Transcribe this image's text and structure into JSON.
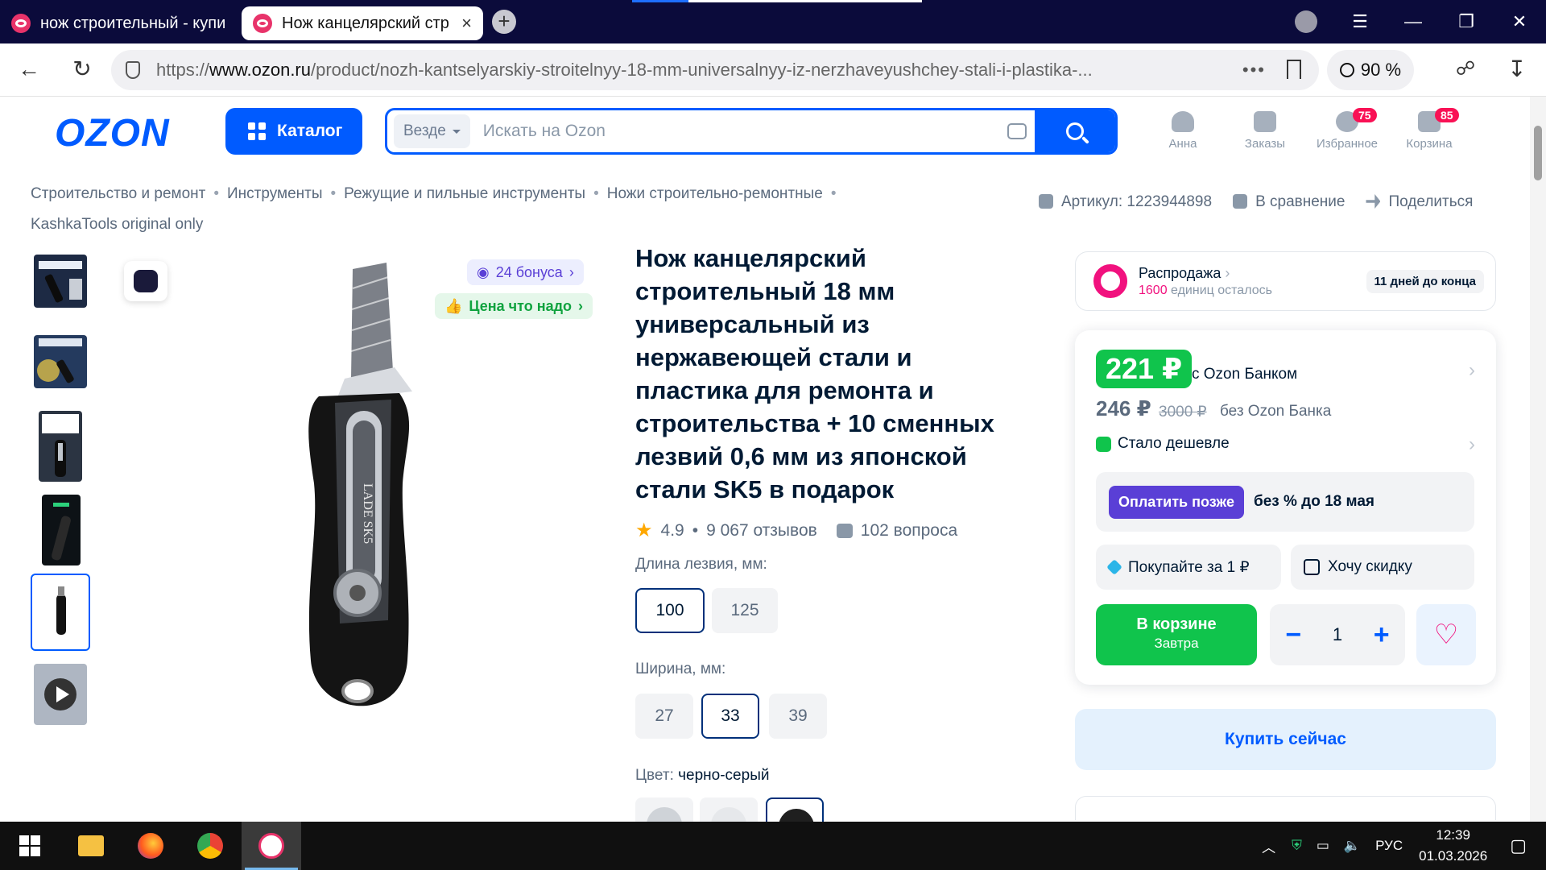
{
  "browser": {
    "tabs": [
      {
        "title": "нож строительный - купи",
        "active": false
      },
      {
        "title": "Нож канцелярский стр",
        "active": true
      }
    ],
    "new_tab": "+",
    "close": "×",
    "url_prefix": "https://",
    "url_host": "www.ozon.ru",
    "url_path": "/product/nozh-kantselyarskiy-stroitelnyy-18-mm-universalnyy-iz-nerzhaveyushchey-stali-i-plastika-...",
    "zoom": "90 %",
    "window_controls": [
      "☰",
      "—",
      "❐",
      "✕"
    ]
  },
  "header": {
    "logo": "OZON",
    "catalog_label": "Каталог",
    "search_scope": "Везде",
    "search_placeholder": "Искать на Ozon",
    "user": {
      "label": "Анна"
    },
    "orders": {
      "label": "Заказы"
    },
    "favorites": {
      "label": "Избранное",
      "count": "75"
    },
    "cart": {
      "label": "Корзина",
      "count": "85"
    }
  },
  "breadcrumb": [
    "Строительство и ремонт",
    "Инструменты",
    "Режущие и пильные инструменты",
    "Ножи строительно-ремонтные",
    "KashkaTools original only"
  ],
  "article_bar": {
    "article": "Артикул: 1223944898",
    "compare": "В сравнение",
    "share": "Поделиться"
  },
  "gallery": {
    "bonus": "24 бонуса",
    "price_tag": "Цена что надо"
  },
  "product": {
    "title": "Нож канцелярский строительный 18 мм универсальный из нержавеющей стали и пластика для ремонта и строительства + 10 сменных лезвий 0,6 мм из японской стали SK5 в подарок",
    "rating": "4.9",
    "reviews": "9 067 отзывов",
    "questions": "102 вопроса",
    "blade_length_label": "Длина лезвия, мм:",
    "blade_lengths": [
      "100",
      "125"
    ],
    "blade_length_selected": "100",
    "width_label": "Ширина, мм:",
    "widths": [
      "27",
      "33",
      "39"
    ],
    "width_selected": "33",
    "color_label": "Цвет:",
    "color_value": "черно-серый"
  },
  "sale": {
    "title": "Распродажа",
    "remaining_count": "1600",
    "remaining_text": "единиц осталось",
    "days_left": "11 дней до конца"
  },
  "pricing": {
    "bank_price": "221 ₽",
    "bank_label": "с Ozon Банком",
    "price": "246 ₽",
    "old_price": "3000 ₽",
    "no_bank_label": "без Ozon Банка",
    "cheaper": "Стало дешевле",
    "pay_later": "Оплатить позже",
    "pay_later_terms": "без % до 18 мая",
    "buy_for_1": "Покупайте за 1 ₽",
    "want_discount": "Хочу скидку",
    "in_cart": "В корзине",
    "delivery": "Завтра",
    "quantity": "1",
    "minus": "−",
    "plus": "+",
    "buy_now": "Купить сейчас"
  },
  "taskbar": {
    "lang": "РУС",
    "time": "12:39",
    "date": "01.03.2026"
  },
  "colors": {
    "brand_blue": "#005bff",
    "green": "#10c44c",
    "pink": "#f1117e",
    "purple": "#5a3fd6"
  }
}
